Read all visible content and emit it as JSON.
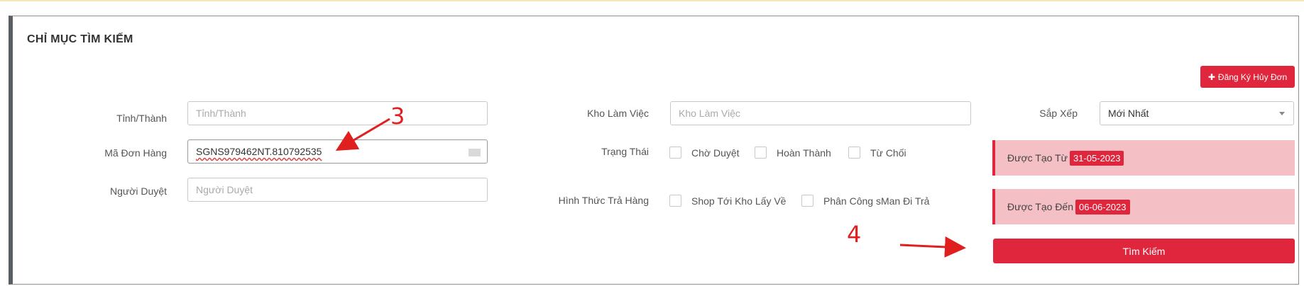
{
  "panel": {
    "title": "CHỈ MỤC TÌM KIẾM"
  },
  "register_button": {
    "icon": "plus-icon",
    "label": "Đăng Ký Hủy Đơn"
  },
  "fields": {
    "province": {
      "label": "Tỉnh/Thành",
      "placeholder": "Tỉnh/Thành",
      "value": ""
    },
    "order_code": {
      "label": "Mã Đơn Hàng",
      "value": "SGNS979462NT.810792535"
    },
    "approver": {
      "label": "Người Duyệt",
      "placeholder": "Người Duyệt",
      "value": ""
    },
    "warehouse": {
      "label": "Kho Làm Việc",
      "placeholder": "Kho Làm Việc",
      "value": ""
    },
    "sort": {
      "label": "Sắp Xếp",
      "selected": "Mới Nhất"
    }
  },
  "status": {
    "label": "Trạng Thái",
    "options": [
      "Chờ Duyệt",
      "Hoàn Thành",
      "Từ Chối"
    ]
  },
  "return_method": {
    "label": "Hình Thức Trả Hàng",
    "options": [
      "Shop Tới Kho Lấy Về",
      "Phân Công sMan Đi Trả"
    ]
  },
  "created_from": {
    "label": "Được Tạo Từ",
    "date": "31-05-2023"
  },
  "created_to": {
    "label": "Được Tạo Đến",
    "date": "06-06-2023"
  },
  "search_button": {
    "label": "Tìm Kiếm"
  },
  "annotations": {
    "step3": "3",
    "step4": "4"
  },
  "colors": {
    "accent": "#e0263c",
    "date_bg": "#f5c0c5",
    "annotation": "#e01f1f"
  }
}
